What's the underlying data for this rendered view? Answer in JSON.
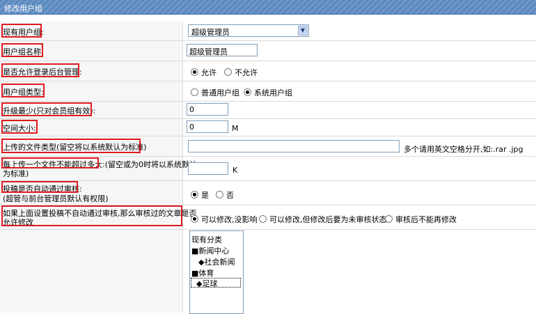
{
  "header": {
    "title": "修改用户组"
  },
  "rows": {
    "group": {
      "label": "现有用户组:",
      "value": "超级管理员"
    },
    "name": {
      "label": "用户组名称:",
      "value": "超级管理员"
    },
    "backend": {
      "label": "是否允许登录后台管理:",
      "opt1": "允许",
      "opt2": "不允许"
    },
    "type": {
      "label": "用户组类型:",
      "opt1": "普通用户组",
      "opt2": "系统用户组"
    },
    "upgrade": {
      "label": "升级最少(只对会员组有效):",
      "value": "0"
    },
    "space": {
      "label": "空间大小:",
      "value": "0",
      "unit": "M"
    },
    "filetype": {
      "label": "上传的文件类型(留空将以系统默认为标准)",
      "value": "",
      "hint": "多个请用英文空格分开,如:.rar .jpg"
    },
    "maxsize": {
      "label_a": "每上传一个文件不能超过多大:",
      "label_b": "留空或为0时将以系统默认",
      "label_c": "为标准)",
      "value": "",
      "unit": "K"
    },
    "audit": {
      "label": "投稿是否自动通过审核:",
      "sub": "(超管与前台管理员默认有权限)",
      "opt1": "是",
      "opt2": "否"
    },
    "modify": {
      "label_a": "如果上面设置投稿不自动通过审核,那么审核过的文章是否",
      "label_b": "允许修改",
      "opt1": "可以修改,没影响",
      "opt2": "可以修改,但修改后要为未审核状态",
      "opt3": "审核后不能再修改"
    }
  },
  "categories": {
    "items": [
      "现有分类",
      "■新闻中心",
      "◆社会新闻",
      "■体育",
      "◆足球"
    ]
  }
}
